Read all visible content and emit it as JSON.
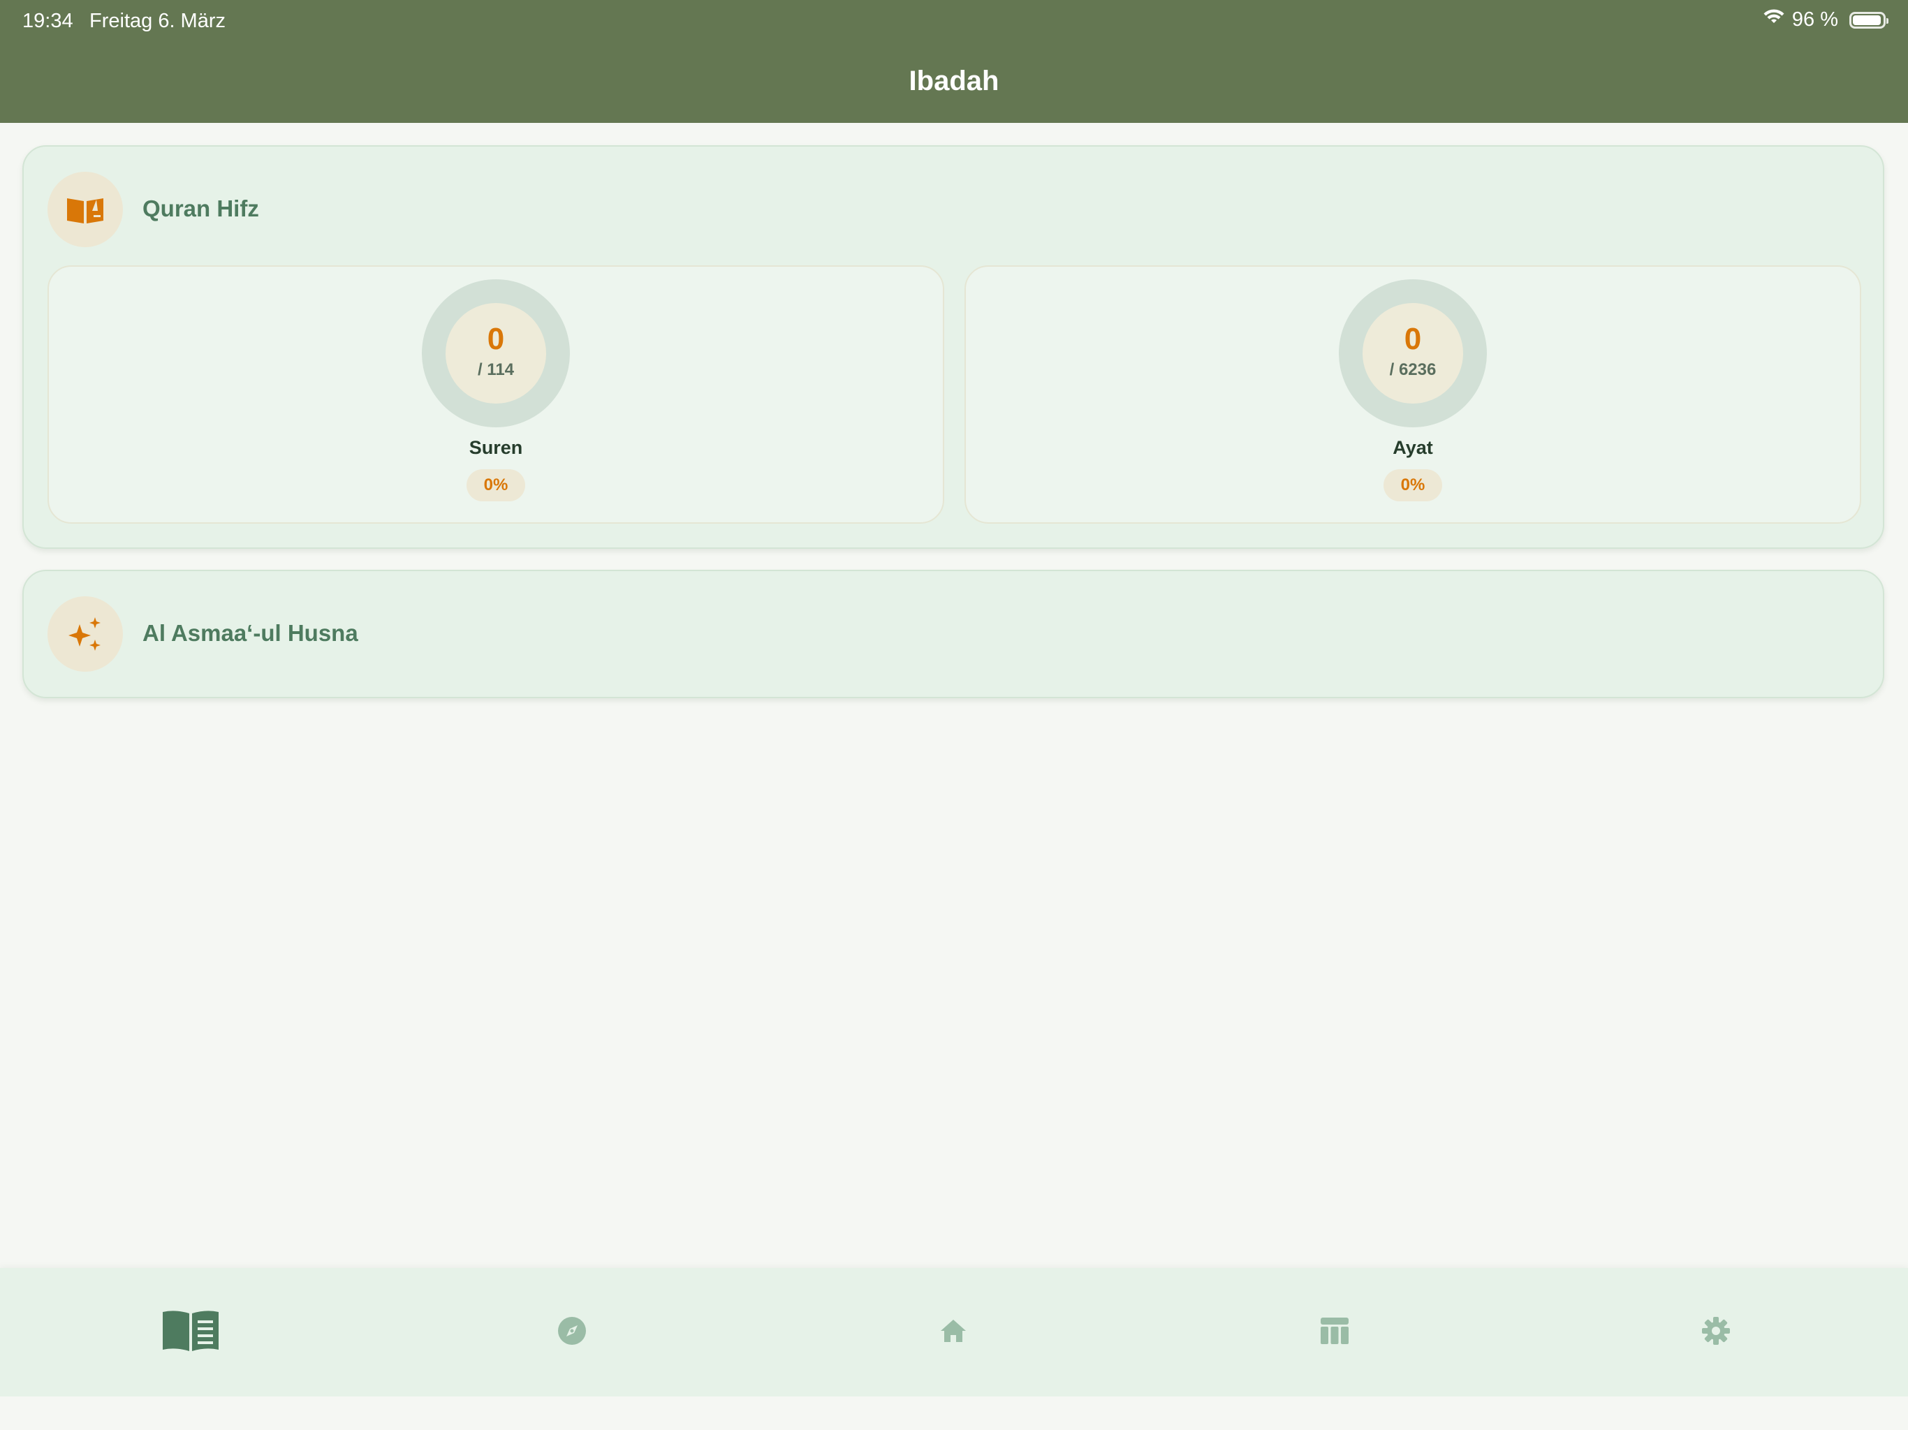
{
  "status_bar": {
    "time": "19:34",
    "date": "Freitag 6. März",
    "battery_text": "96 %",
    "battery_level": 0.96
  },
  "header": {
    "title": "Ibadah"
  },
  "colors": {
    "header_bg": "#647752",
    "accent_orange": "#d97708",
    "card_bg": "#e6f2e8",
    "title_green": "#4e7b5f"
  },
  "quran_hifz": {
    "title": "Quran Hifz",
    "icon": "open-book-icon",
    "stats": [
      {
        "value": "0",
        "total": "/ 114",
        "label": "Suren",
        "percent": "0%",
        "progress": 0
      },
      {
        "value": "0",
        "total": "/ 6236",
        "label": "Ayat",
        "percent": "0%",
        "progress": 0
      }
    ]
  },
  "asmaa_ul_husna": {
    "title": "Al Asmaa‘-ul Husna",
    "icon": "sparkles-icon"
  },
  "tab_bar": {
    "items": [
      {
        "icon": "reader-book-icon",
        "active": true
      },
      {
        "icon": "compass-icon",
        "active": false
      },
      {
        "icon": "home-icon",
        "active": false
      },
      {
        "icon": "table-icon",
        "active": false
      },
      {
        "icon": "gear-icon",
        "active": false
      }
    ]
  }
}
